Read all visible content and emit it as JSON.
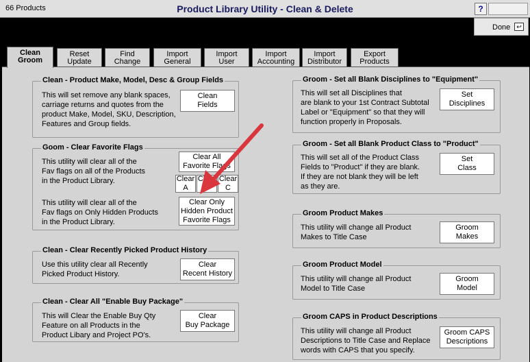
{
  "window": {
    "product_count": "66 Products",
    "title": "Product Library Utility - Clean & Delete",
    "help": "?",
    "done": "Done"
  },
  "tabs": [
    {
      "l1": "Clean",
      "l2": "Groom"
    },
    {
      "l1": "Reset",
      "l2": "Update"
    },
    {
      "l1": "Find",
      "l2": "Change"
    },
    {
      "l1": "Import",
      "l2": "General"
    },
    {
      "l1": "Import",
      "l2": "User"
    },
    {
      "l1": "Import",
      "l2": "Accounting"
    },
    {
      "l1": "Import",
      "l2": "Distributor"
    },
    {
      "l1": "Export",
      "l2": "Products"
    }
  ],
  "clean_fields": {
    "title": "Clean - Product Make, Model, Desc & Group Fields",
    "desc": [
      "This will set remove any blank spaces,",
      "carriage returns and quotes from the",
      "product Make, Model, SKU, Description,",
      "Features and Group fields."
    ],
    "btn": [
      "Clean",
      "Fields"
    ]
  },
  "fav_flags": {
    "title": "Goom - Clear Favorite Flags",
    "desc1": [
      "This utility will clear all of the",
      "Fav flags on all of the Products",
      "in the Product Library."
    ],
    "btn_all": [
      "Clear All",
      "Favorite Flags"
    ],
    "btn_a": [
      "Clear",
      "A"
    ],
    "btn_b": [
      "Clear",
      "B"
    ],
    "btn_c": [
      "Clear",
      "C"
    ],
    "desc2": [
      "This utility will clear all of the",
      "Fav flags on Only Hidden Products",
      "in the Product Library."
    ],
    "btn_hidden": [
      "Clear Only",
      "Hidden Product",
      "Favorite Flags"
    ]
  },
  "recent_history": {
    "title": "Clean - Clear Recently Picked Product History",
    "desc": [
      "Use this utility clear all Recently",
      "Picked Product History."
    ],
    "btn": [
      "Clear",
      "Recent History"
    ]
  },
  "buy_package": {
    "title": "Clean - Clear All \"Enable Buy Package\"",
    "desc": [
      "This will Clear the Enable Buy Qty",
      "Feature on all Products in the",
      "Product Libary and Project PO's."
    ],
    "btn": [
      "Clear",
      "Buy Package"
    ]
  },
  "disciplines": {
    "title": "Groom - Set all Blank Disciplines to \"Equipment\"",
    "desc": [
      "This will set all Disciplines that",
      "are blank to your 1st Contract Subtotal",
      "Label or \"Equipment\" so that they will",
      "function properly in Proposals."
    ],
    "btn": [
      "Set",
      "Disciplines"
    ]
  },
  "product_class": {
    "title": "Groom - Set all Blank Product Class to \"Product\"",
    "desc": [
      "This will set all of the Product Class",
      "Fields to \"Product\" if they are blank.",
      "If they are not blank they will be left",
      "as they are."
    ],
    "btn": [
      "Set",
      "Class"
    ]
  },
  "makes": {
    "title": "Groom Product Makes",
    "desc": [
      "This utility will change all Product",
      "Makes to Title Case"
    ],
    "btn": [
      "Groom",
      "Makes"
    ]
  },
  "model": {
    "title": "Groom Product Model",
    "desc": [
      "This utility will change all Product",
      "Model to Title Case"
    ],
    "btn": [
      "Groom",
      "Model"
    ]
  },
  "caps": {
    "title": "Groom CAPS in Product Descriptions",
    "desc": [
      "This utility will change all Product",
      "Descriptions to Title Case and Replace",
      "words with CAPS that you specify."
    ],
    "btn": [
      "Groom CAPS",
      "Descriptions"
    ]
  },
  "colors": {
    "panel": "#d4d4d4",
    "title_text": "#1a1a5e",
    "arrow": "#d9363e",
    "background": "#000000"
  }
}
